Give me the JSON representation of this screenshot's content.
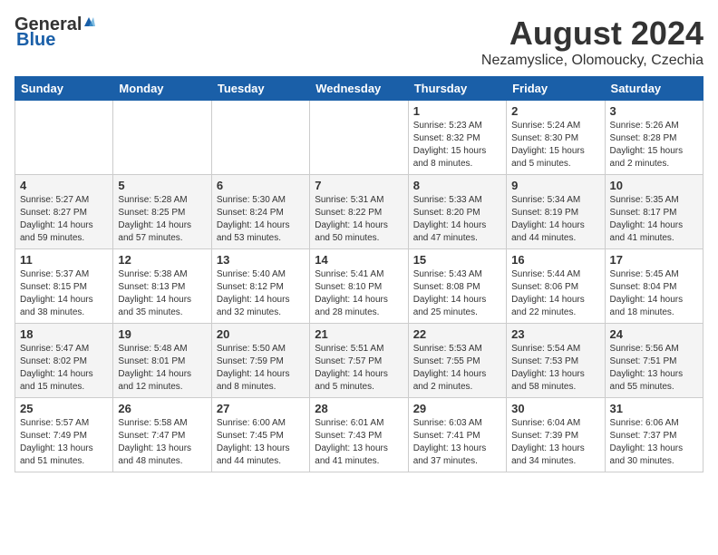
{
  "header": {
    "logo": {
      "general": "General",
      "blue": "Blue"
    },
    "title": "August 2024",
    "subtitle": "Nezamyslice, Olomoucky, Czechia"
  },
  "calendar": {
    "days_of_week": [
      "Sunday",
      "Monday",
      "Tuesday",
      "Wednesday",
      "Thursday",
      "Friday",
      "Saturday"
    ],
    "weeks": [
      [
        {
          "day": "",
          "info": ""
        },
        {
          "day": "",
          "info": ""
        },
        {
          "day": "",
          "info": ""
        },
        {
          "day": "",
          "info": ""
        },
        {
          "day": "1",
          "info": "Sunrise: 5:23 AM\nSunset: 8:32 PM\nDaylight: 15 hours and 8 minutes."
        },
        {
          "day": "2",
          "info": "Sunrise: 5:24 AM\nSunset: 8:30 PM\nDaylight: 15 hours and 5 minutes."
        },
        {
          "day": "3",
          "info": "Sunrise: 5:26 AM\nSunset: 8:28 PM\nDaylight: 15 hours and 2 minutes."
        }
      ],
      [
        {
          "day": "4",
          "info": "Sunrise: 5:27 AM\nSunset: 8:27 PM\nDaylight: 14 hours and 59 minutes."
        },
        {
          "day": "5",
          "info": "Sunrise: 5:28 AM\nSunset: 8:25 PM\nDaylight: 14 hours and 57 minutes."
        },
        {
          "day": "6",
          "info": "Sunrise: 5:30 AM\nSunset: 8:24 PM\nDaylight: 14 hours and 53 minutes."
        },
        {
          "day": "7",
          "info": "Sunrise: 5:31 AM\nSunset: 8:22 PM\nDaylight: 14 hours and 50 minutes."
        },
        {
          "day": "8",
          "info": "Sunrise: 5:33 AM\nSunset: 8:20 PM\nDaylight: 14 hours and 47 minutes."
        },
        {
          "day": "9",
          "info": "Sunrise: 5:34 AM\nSunset: 8:19 PM\nDaylight: 14 hours and 44 minutes."
        },
        {
          "day": "10",
          "info": "Sunrise: 5:35 AM\nSunset: 8:17 PM\nDaylight: 14 hours and 41 minutes."
        }
      ],
      [
        {
          "day": "11",
          "info": "Sunrise: 5:37 AM\nSunset: 8:15 PM\nDaylight: 14 hours and 38 minutes."
        },
        {
          "day": "12",
          "info": "Sunrise: 5:38 AM\nSunset: 8:13 PM\nDaylight: 14 hours and 35 minutes."
        },
        {
          "day": "13",
          "info": "Sunrise: 5:40 AM\nSunset: 8:12 PM\nDaylight: 14 hours and 32 minutes."
        },
        {
          "day": "14",
          "info": "Sunrise: 5:41 AM\nSunset: 8:10 PM\nDaylight: 14 hours and 28 minutes."
        },
        {
          "day": "15",
          "info": "Sunrise: 5:43 AM\nSunset: 8:08 PM\nDaylight: 14 hours and 25 minutes."
        },
        {
          "day": "16",
          "info": "Sunrise: 5:44 AM\nSunset: 8:06 PM\nDaylight: 14 hours and 22 minutes."
        },
        {
          "day": "17",
          "info": "Sunrise: 5:45 AM\nSunset: 8:04 PM\nDaylight: 14 hours and 18 minutes."
        }
      ],
      [
        {
          "day": "18",
          "info": "Sunrise: 5:47 AM\nSunset: 8:02 PM\nDaylight: 14 hours and 15 minutes."
        },
        {
          "day": "19",
          "info": "Sunrise: 5:48 AM\nSunset: 8:01 PM\nDaylight: 14 hours and 12 minutes."
        },
        {
          "day": "20",
          "info": "Sunrise: 5:50 AM\nSunset: 7:59 PM\nDaylight: 14 hours and 8 minutes."
        },
        {
          "day": "21",
          "info": "Sunrise: 5:51 AM\nSunset: 7:57 PM\nDaylight: 14 hours and 5 minutes."
        },
        {
          "day": "22",
          "info": "Sunrise: 5:53 AM\nSunset: 7:55 PM\nDaylight: 14 hours and 2 minutes."
        },
        {
          "day": "23",
          "info": "Sunrise: 5:54 AM\nSunset: 7:53 PM\nDaylight: 13 hours and 58 minutes."
        },
        {
          "day": "24",
          "info": "Sunrise: 5:56 AM\nSunset: 7:51 PM\nDaylight: 13 hours and 55 minutes."
        }
      ],
      [
        {
          "day": "25",
          "info": "Sunrise: 5:57 AM\nSunset: 7:49 PM\nDaylight: 13 hours and 51 minutes."
        },
        {
          "day": "26",
          "info": "Sunrise: 5:58 AM\nSunset: 7:47 PM\nDaylight: 13 hours and 48 minutes."
        },
        {
          "day": "27",
          "info": "Sunrise: 6:00 AM\nSunset: 7:45 PM\nDaylight: 13 hours and 44 minutes."
        },
        {
          "day": "28",
          "info": "Sunrise: 6:01 AM\nSunset: 7:43 PM\nDaylight: 13 hours and 41 minutes."
        },
        {
          "day": "29",
          "info": "Sunrise: 6:03 AM\nSunset: 7:41 PM\nDaylight: 13 hours and 37 minutes."
        },
        {
          "day": "30",
          "info": "Sunrise: 6:04 AM\nSunset: 7:39 PM\nDaylight: 13 hours and 34 minutes."
        },
        {
          "day": "31",
          "info": "Sunrise: 6:06 AM\nSunset: 7:37 PM\nDaylight: 13 hours and 30 minutes."
        }
      ]
    ]
  }
}
